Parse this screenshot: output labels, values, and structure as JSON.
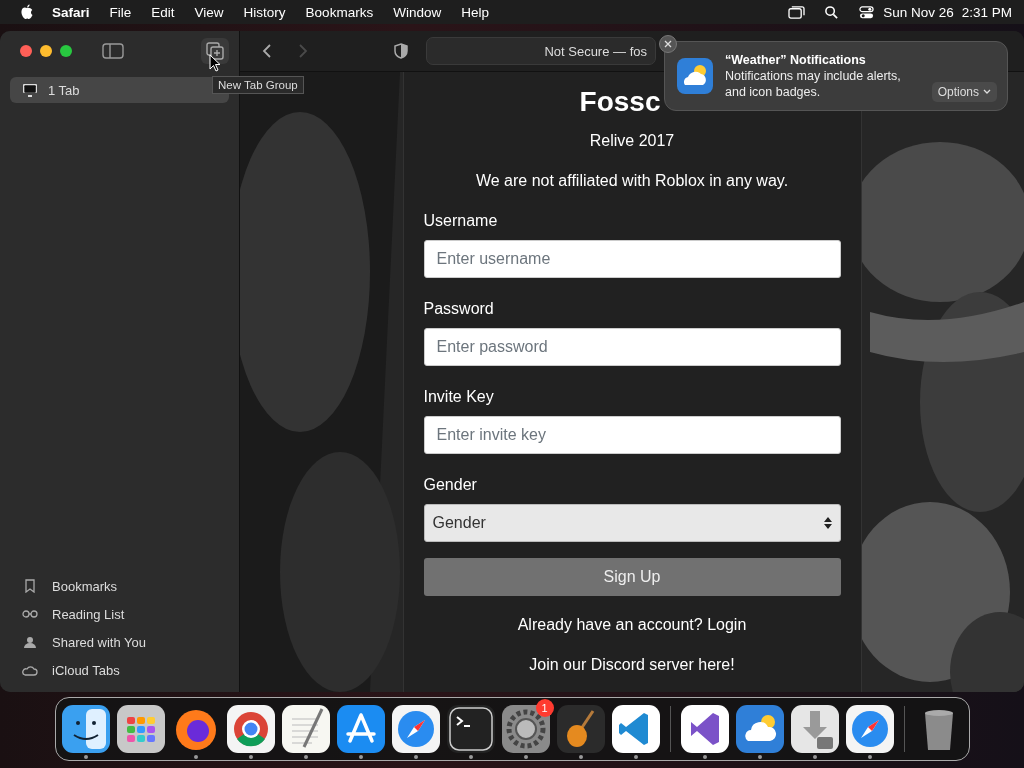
{
  "menu_bar": {
    "app": "Safari",
    "menus": [
      "File",
      "Edit",
      "View",
      "History",
      "Bookmarks",
      "Window",
      "Help"
    ],
    "date": "Sun Nov 26",
    "time": "2:31 PM"
  },
  "tooltip": "New Tab Group",
  "toolbar": {
    "back_disabled": false,
    "forward_disabled": true,
    "address": "Not Secure — fos"
  },
  "sidebar": {
    "tabs": [
      {
        "label": "1 Tab",
        "selected": true
      }
    ],
    "items": [
      {
        "kind": "bookmarks",
        "label": "Bookmarks"
      },
      {
        "kind": "reading",
        "label": "Reading List"
      },
      {
        "kind": "shared",
        "label": "Shared with You"
      },
      {
        "kind": "icloud",
        "label": "iCloud Tabs"
      }
    ]
  },
  "page": {
    "title": "Fossc",
    "subtitle": "Relive 2017",
    "notice": "We are not affiliated with Roblox in any way.",
    "fields": [
      {
        "label": "Username",
        "placeholder": "Enter username"
      },
      {
        "label": "Password",
        "placeholder": "Enter password"
      },
      {
        "label": "Invite Key",
        "placeholder": "Enter invite key"
      }
    ],
    "select": {
      "label": "Gender",
      "value": "Gender"
    },
    "submit": {
      "label": "Sign Up",
      "disabled": true
    },
    "links": [
      "Already have an account? Login",
      "Join our Discord server here!"
    ]
  },
  "notification": {
    "title": "“Weather” Notifications",
    "body": [
      "Notifications may include alerts,",
      "and icon badges."
    ],
    "action": "Options"
  },
  "dock": {
    "items": [
      {
        "kind": "finder",
        "running": true
      },
      {
        "kind": "launchpad",
        "running": false
      },
      {
        "kind": "firefox",
        "running": true
      },
      {
        "kind": "chrome",
        "running": true
      },
      {
        "kind": "textedit",
        "running": true
      },
      {
        "kind": "appstore",
        "running": true
      },
      {
        "kind": "safari",
        "running": true
      },
      {
        "kind": "terminal",
        "running": true
      },
      {
        "kind": "settings",
        "running": true,
        "badge": "1"
      },
      {
        "kind": "garageband",
        "running": true
      },
      {
        "kind": "vscode",
        "running": true
      },
      {
        "kind": "divider"
      },
      {
        "kind": "visualstudio",
        "running": true
      },
      {
        "kind": "weather",
        "running": true
      },
      {
        "kind": "installer",
        "running": true
      },
      {
        "kind": "safari",
        "running": true
      },
      {
        "kind": "divider"
      },
      {
        "kind": "trash",
        "running": false
      }
    ]
  }
}
